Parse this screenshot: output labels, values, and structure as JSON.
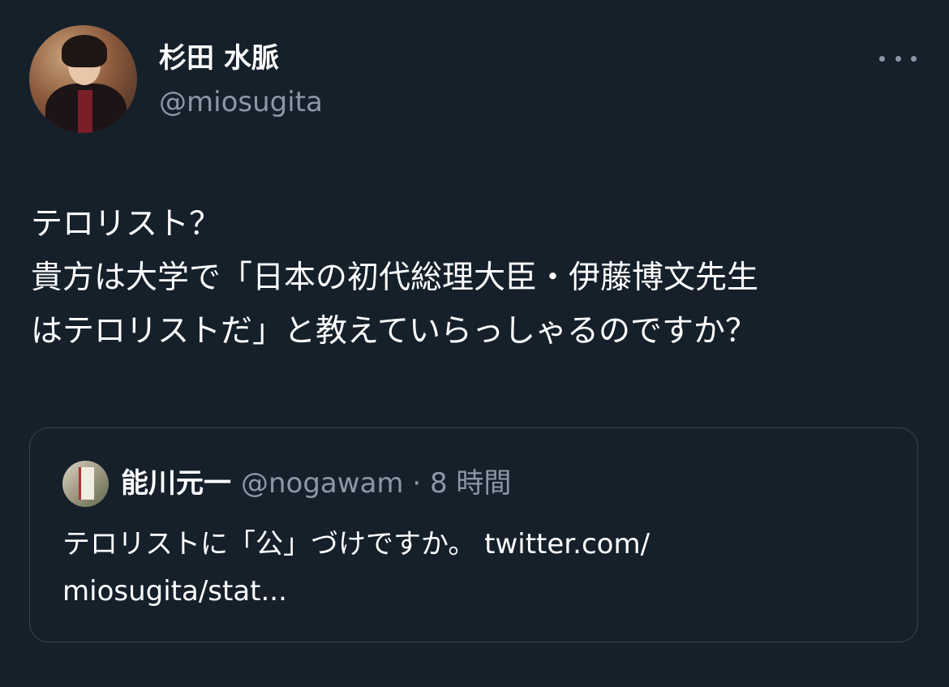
{
  "author": {
    "name": "杉田 水脈",
    "handle": "@miosugita",
    "avatar_icon": "profile-photo"
  },
  "more_icon": "more-horizontal-icon",
  "tweet": {
    "lines": [
      "テロリスト？",
      "貴方は大学で「日本の初代総理大臣・伊藤博文先生",
      "はテロリストだ」と教えていらっしゃるのですか？"
    ]
  },
  "quoted": {
    "name": "能川元一",
    "handle": "@nogawam",
    "meta": "@nogawam · 8 時間",
    "lines": [
      "テロリストに「公」づけですか。 twitter.com/",
      "miosugita/stat..."
    ]
  },
  "colors": {
    "background": "#15202b",
    "secondary_text": "#8b98a5",
    "border": "#38444d"
  }
}
